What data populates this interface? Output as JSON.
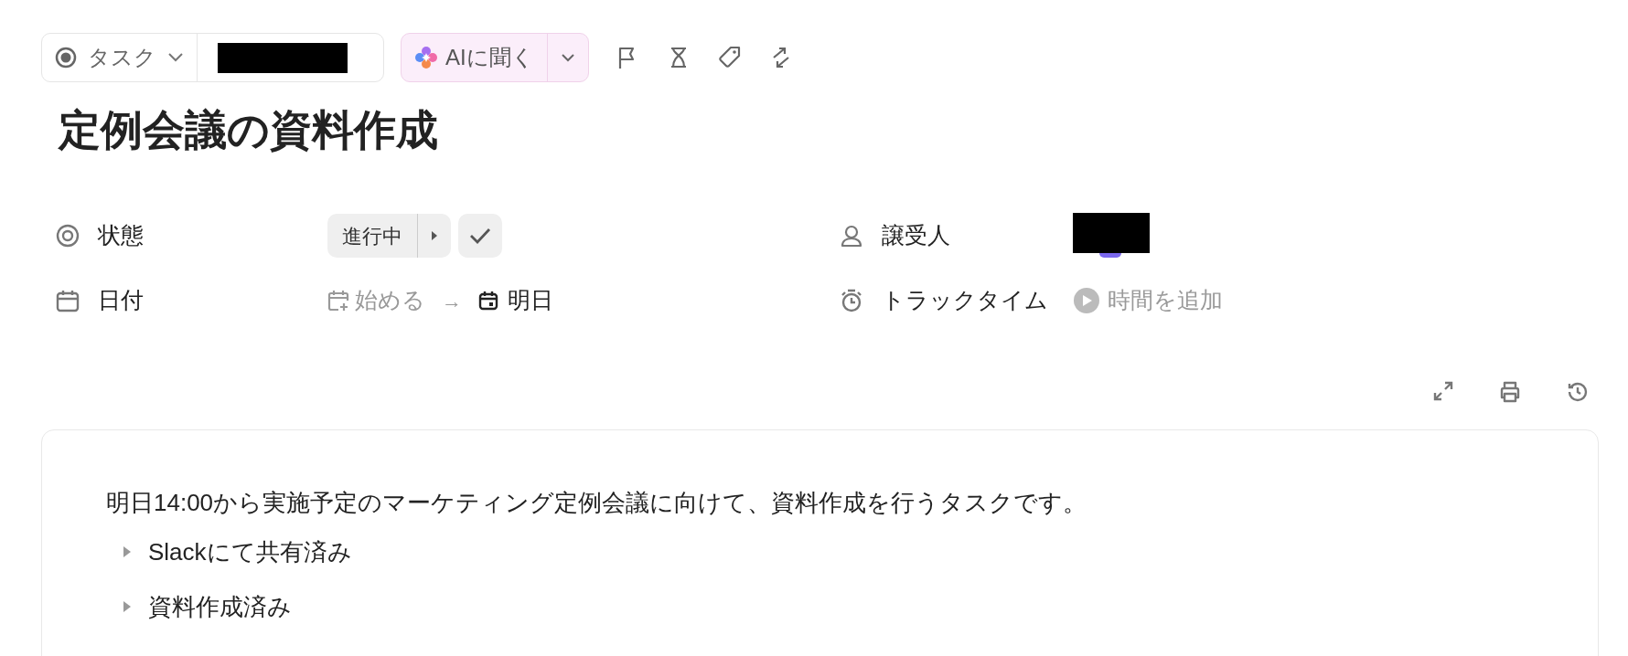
{
  "toolbar": {
    "type_label": "タスク",
    "ai_button": "AIに聞く"
  },
  "title": "定例会議の資料作成",
  "properties": [
    {
      "kind": "status",
      "label": "状態",
      "value": "進行中"
    },
    {
      "kind": "assignee",
      "label": "譲受人"
    },
    {
      "kind": "date",
      "label": "日付",
      "start": "始める",
      "arrow": "→",
      "due": "明日"
    },
    {
      "kind": "time",
      "label": "トラックタイム",
      "value": "時間を追加"
    }
  ],
  "description": {
    "text": "明日14:00から実施予定のマーケティング定例会議に向けて、資料作成を行うタスクです。",
    "toggles": [
      {
        "text": "Slackにて共有済み",
        "expanded": false
      },
      {
        "text": "資料作成済み",
        "expanded": false
      }
    ]
  }
}
